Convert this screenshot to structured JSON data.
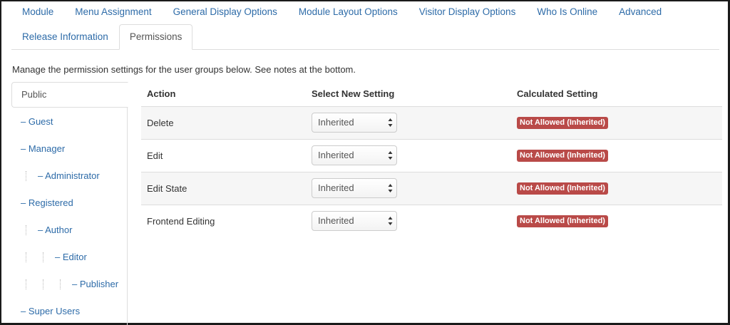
{
  "tabs_row1": [
    "Module",
    "Menu Assignment",
    "General Display Options",
    "Module Layout Options",
    "Visitor Display Options",
    "Who Is Online",
    "Advanced"
  ],
  "tabs_row2": [
    "Release Information",
    "Permissions"
  ],
  "active_tab": "Permissions",
  "intro": "Manage the permission settings for the user groups below. See notes at the bottom.",
  "groups": [
    {
      "label": "Public",
      "level": 0
    },
    {
      "label": "– Guest",
      "level": 1
    },
    {
      "label": "– Manager",
      "level": 1
    },
    {
      "label": "– Administrator",
      "level": 2
    },
    {
      "label": "– Registered",
      "level": 1
    },
    {
      "label": "– Author",
      "level": 2
    },
    {
      "label": "– Editor",
      "level": 3
    },
    {
      "label": "– Publisher",
      "level": 4
    },
    {
      "label": "– Super Users",
      "level": 1
    }
  ],
  "active_group": "Public",
  "table": {
    "headers": [
      "Action",
      "Select New Setting",
      "Calculated Setting"
    ],
    "rows": [
      {
        "action": "Delete",
        "setting": "Inherited",
        "calculated": "Not Allowed (Inherited)"
      },
      {
        "action": "Edit",
        "setting": "Inherited",
        "calculated": "Not Allowed (Inherited)"
      },
      {
        "action": "Edit State",
        "setting": "Inherited",
        "calculated": "Not Allowed (Inherited)"
      },
      {
        "action": "Frontend Editing",
        "setting": "Inherited",
        "calculated": "Not Allowed (Inherited)"
      }
    ]
  },
  "colors": {
    "link": "#2d6ba8",
    "badge_danger": "#b94a48",
    "row_stripe": "#f6f6f6"
  }
}
